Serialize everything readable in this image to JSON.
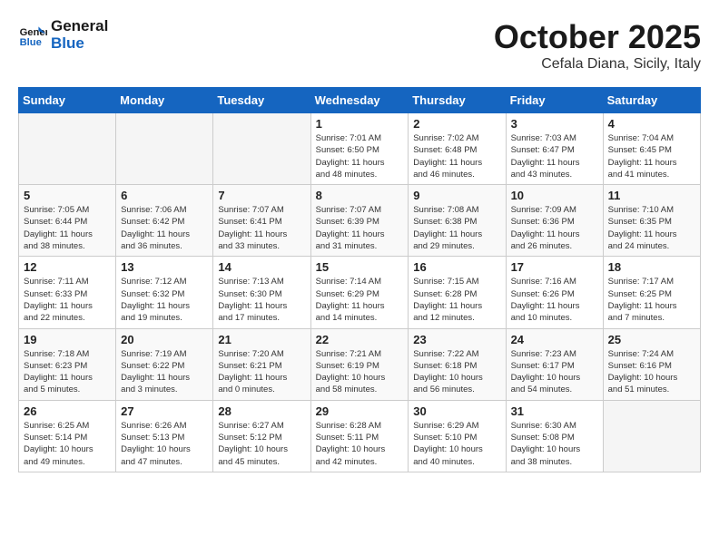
{
  "header": {
    "logo_line1": "General",
    "logo_line2": "Blue",
    "month": "October 2025",
    "location": "Cefala Diana, Sicily, Italy"
  },
  "weekdays": [
    "Sunday",
    "Monday",
    "Tuesday",
    "Wednesday",
    "Thursday",
    "Friday",
    "Saturday"
  ],
  "weeks": [
    [
      {
        "day": "",
        "info": ""
      },
      {
        "day": "",
        "info": ""
      },
      {
        "day": "",
        "info": ""
      },
      {
        "day": "1",
        "info": "Sunrise: 7:01 AM\nSunset: 6:50 PM\nDaylight: 11 hours\nand 48 minutes."
      },
      {
        "day": "2",
        "info": "Sunrise: 7:02 AM\nSunset: 6:48 PM\nDaylight: 11 hours\nand 46 minutes."
      },
      {
        "day": "3",
        "info": "Sunrise: 7:03 AM\nSunset: 6:47 PM\nDaylight: 11 hours\nand 43 minutes."
      },
      {
        "day": "4",
        "info": "Sunrise: 7:04 AM\nSunset: 6:45 PM\nDaylight: 11 hours\nand 41 minutes."
      }
    ],
    [
      {
        "day": "5",
        "info": "Sunrise: 7:05 AM\nSunset: 6:44 PM\nDaylight: 11 hours\nand 38 minutes."
      },
      {
        "day": "6",
        "info": "Sunrise: 7:06 AM\nSunset: 6:42 PM\nDaylight: 11 hours\nand 36 minutes."
      },
      {
        "day": "7",
        "info": "Sunrise: 7:07 AM\nSunset: 6:41 PM\nDaylight: 11 hours\nand 33 minutes."
      },
      {
        "day": "8",
        "info": "Sunrise: 7:07 AM\nSunset: 6:39 PM\nDaylight: 11 hours\nand 31 minutes."
      },
      {
        "day": "9",
        "info": "Sunrise: 7:08 AM\nSunset: 6:38 PM\nDaylight: 11 hours\nand 29 minutes."
      },
      {
        "day": "10",
        "info": "Sunrise: 7:09 AM\nSunset: 6:36 PM\nDaylight: 11 hours\nand 26 minutes."
      },
      {
        "day": "11",
        "info": "Sunrise: 7:10 AM\nSunset: 6:35 PM\nDaylight: 11 hours\nand 24 minutes."
      }
    ],
    [
      {
        "day": "12",
        "info": "Sunrise: 7:11 AM\nSunset: 6:33 PM\nDaylight: 11 hours\nand 22 minutes."
      },
      {
        "day": "13",
        "info": "Sunrise: 7:12 AM\nSunset: 6:32 PM\nDaylight: 11 hours\nand 19 minutes."
      },
      {
        "day": "14",
        "info": "Sunrise: 7:13 AM\nSunset: 6:30 PM\nDaylight: 11 hours\nand 17 minutes."
      },
      {
        "day": "15",
        "info": "Sunrise: 7:14 AM\nSunset: 6:29 PM\nDaylight: 11 hours\nand 14 minutes."
      },
      {
        "day": "16",
        "info": "Sunrise: 7:15 AM\nSunset: 6:28 PM\nDaylight: 11 hours\nand 12 minutes."
      },
      {
        "day": "17",
        "info": "Sunrise: 7:16 AM\nSunset: 6:26 PM\nDaylight: 11 hours\nand 10 minutes."
      },
      {
        "day": "18",
        "info": "Sunrise: 7:17 AM\nSunset: 6:25 PM\nDaylight: 11 hours\nand 7 minutes."
      }
    ],
    [
      {
        "day": "19",
        "info": "Sunrise: 7:18 AM\nSunset: 6:23 PM\nDaylight: 11 hours\nand 5 minutes."
      },
      {
        "day": "20",
        "info": "Sunrise: 7:19 AM\nSunset: 6:22 PM\nDaylight: 11 hours\nand 3 minutes."
      },
      {
        "day": "21",
        "info": "Sunrise: 7:20 AM\nSunset: 6:21 PM\nDaylight: 11 hours\nand 0 minutes."
      },
      {
        "day": "22",
        "info": "Sunrise: 7:21 AM\nSunset: 6:19 PM\nDaylight: 10 hours\nand 58 minutes."
      },
      {
        "day": "23",
        "info": "Sunrise: 7:22 AM\nSunset: 6:18 PM\nDaylight: 10 hours\nand 56 minutes."
      },
      {
        "day": "24",
        "info": "Sunrise: 7:23 AM\nSunset: 6:17 PM\nDaylight: 10 hours\nand 54 minutes."
      },
      {
        "day": "25",
        "info": "Sunrise: 7:24 AM\nSunset: 6:16 PM\nDaylight: 10 hours\nand 51 minutes."
      }
    ],
    [
      {
        "day": "26",
        "info": "Sunrise: 6:25 AM\nSunset: 5:14 PM\nDaylight: 10 hours\nand 49 minutes."
      },
      {
        "day": "27",
        "info": "Sunrise: 6:26 AM\nSunset: 5:13 PM\nDaylight: 10 hours\nand 47 minutes."
      },
      {
        "day": "28",
        "info": "Sunrise: 6:27 AM\nSunset: 5:12 PM\nDaylight: 10 hours\nand 45 minutes."
      },
      {
        "day": "29",
        "info": "Sunrise: 6:28 AM\nSunset: 5:11 PM\nDaylight: 10 hours\nand 42 minutes."
      },
      {
        "day": "30",
        "info": "Sunrise: 6:29 AM\nSunset: 5:10 PM\nDaylight: 10 hours\nand 40 minutes."
      },
      {
        "day": "31",
        "info": "Sunrise: 6:30 AM\nSunset: 5:08 PM\nDaylight: 10 hours\nand 38 minutes."
      },
      {
        "day": "",
        "info": ""
      }
    ]
  ]
}
